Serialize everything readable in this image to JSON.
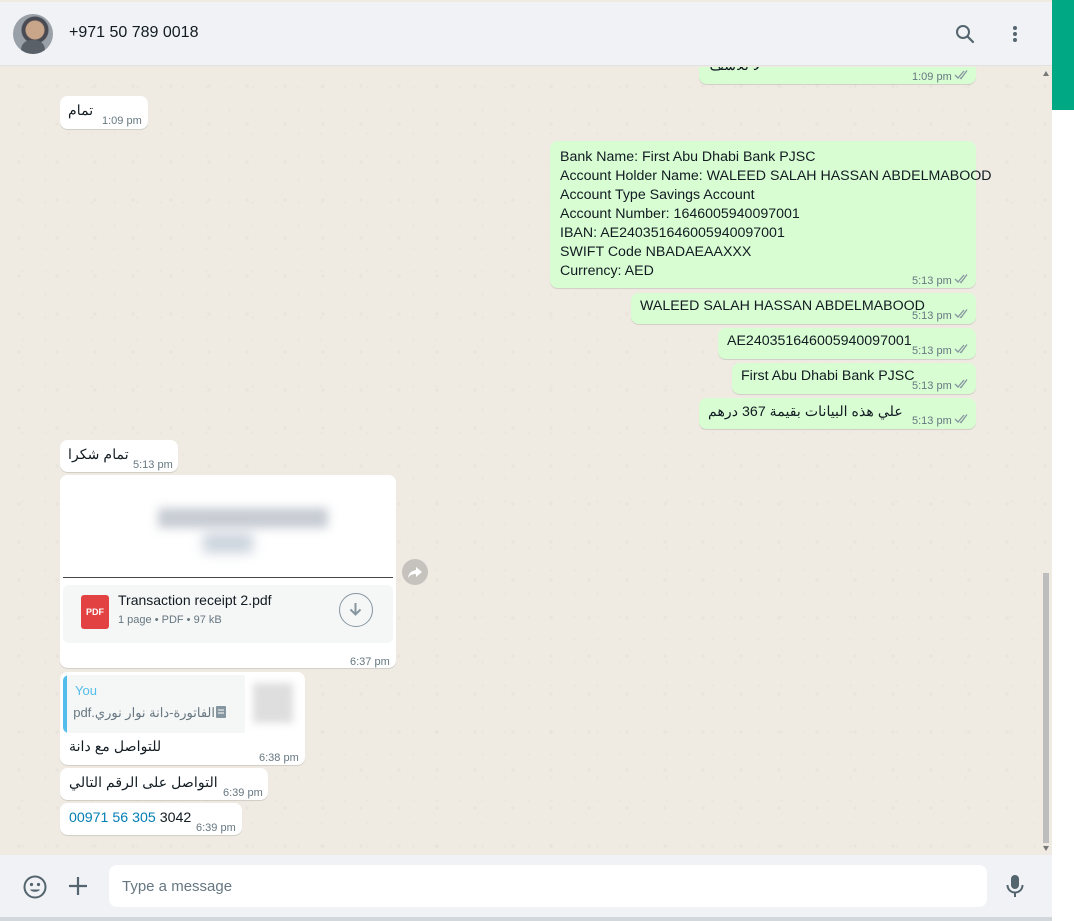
{
  "header": {
    "contact_name": "+971 50 789 0018",
    "icons": [
      "search-icon",
      "menu-icon"
    ]
  },
  "messages": {
    "m0": {
      "text": "لا للأسف",
      "time": "1:09 pm"
    },
    "m1": {
      "text": "تمام",
      "time": "1:09 pm"
    },
    "m2": {
      "lines": [
        "Bank Name: First Abu Dhabi Bank PJSC",
        "Account Holder Name: WALEED SALAH HASSAN ABDELMABOOD",
        "Account Type Savings Account",
        "Account Number: 1646005940097001",
        "IBAN: AE240351646005940097001",
        "SWIFT Code NBADAEAAXXX",
        "Currency: AED"
      ],
      "time": "5:13 pm"
    },
    "m3": {
      "text": "WALEED SALAH HASSAN ABDELMABOOD",
      "time": "5:13 pm"
    },
    "m4": {
      "text": "AE240351646005940097001",
      "time": "5:13 pm"
    },
    "m5": {
      "text": "First Abu Dhabi Bank PJSC",
      "time": "5:13 pm"
    },
    "m6": {
      "text": "علي هذه البيانات بقيمة 367 درهم",
      "time": "5:13 pm"
    },
    "m7": {
      "text": "تمام شكرا",
      "time": "5:13 pm"
    },
    "m8": {
      "file_name": "Transaction receipt 2.pdf",
      "file_meta": "1 page • PDF • 97 kB",
      "file_badge": "PDF",
      "time": "6:37 pm"
    },
    "m9": {
      "quote_author": "You",
      "quote_text": "الفاتورة-دانة نوار نوري.pdf",
      "text": "للتواصل مع دانة",
      "time": "6:38 pm"
    },
    "m10": {
      "text": "التواصل على الرقم التالي",
      "time": "6:39 pm"
    },
    "m11": {
      "link": "00971 56 305",
      "rest": "3042",
      "time": "6:39 pm"
    }
  },
  "composer": {
    "placeholder": "Type a message"
  },
  "colors": {
    "accent": "#00a884",
    "outgoing_bubble": "#d9fdd3",
    "incoming_bubble": "#ffffff",
    "chat_background": "#efeae2",
    "link": "#027eb5"
  }
}
